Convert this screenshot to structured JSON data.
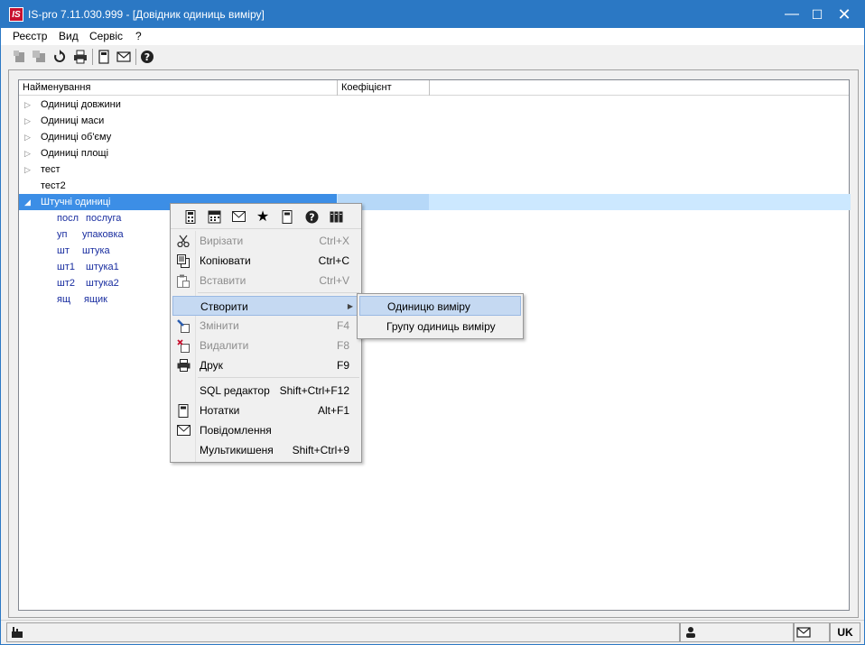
{
  "window": {
    "title": "IS-pro 7.11.030.999 - [Довідник одиниць виміру]",
    "logo_text": "IS"
  },
  "menubar": {
    "items": [
      "Реєстр",
      "Вид",
      "Сервіс",
      "?"
    ]
  },
  "toolbar": {
    "buttons": [
      "add-icon",
      "add-copy-icon",
      "refresh-icon",
      "print-icon",
      "notes-icon",
      "mail-icon",
      "help-icon"
    ]
  },
  "grid": {
    "columns": [
      "Найменування",
      "Коефіцієнт"
    ],
    "groups": [
      {
        "label": "Одиниці довжини",
        "expandable": true
      },
      {
        "label": "Одиниці маси",
        "expandable": true
      },
      {
        "label": "Одиниці об'єму",
        "expandable": true
      },
      {
        "label": "Одиниці площі",
        "expandable": true
      },
      {
        "label": "тест",
        "expandable": true
      },
      {
        "label": "тест2",
        "expandable": false
      },
      {
        "label": "Штучні одиниці",
        "expandable": true,
        "expanded": true,
        "selected": true
      }
    ],
    "children": [
      {
        "code": "посл",
        "name": "послуга"
      },
      {
        "code": "уп",
        "name": "упаковка"
      },
      {
        "code": "шт",
        "name": "штука"
      },
      {
        "code": "шт1",
        "name": "штука1"
      },
      {
        "code": "шт2",
        "name": "штука2"
      },
      {
        "code": "ящ",
        "name": "ящик"
      }
    ]
  },
  "context_menu": {
    "icon_bar": [
      "calculator-icon",
      "calendar-icon",
      "mail-icon",
      "star-icon",
      "notes-icon",
      "help-icon",
      "columns-icon"
    ],
    "items": [
      {
        "label": "Вирізати",
        "shortcut": "Ctrl+X",
        "disabled": true
      },
      {
        "label": "Копіювати",
        "shortcut": "Ctrl+C",
        "disabled": false
      },
      {
        "label": "Вставити",
        "shortcut": "Ctrl+V",
        "disabled": true
      },
      {
        "label": "Створити",
        "shortcut": "",
        "disabled": false,
        "submenu": true
      },
      {
        "label": "Змінити",
        "shortcut": "F4",
        "disabled": true
      },
      {
        "label": "Видалити",
        "shortcut": "F8",
        "disabled": true
      },
      {
        "label": "Друк",
        "shortcut": "F9",
        "disabled": false
      },
      {
        "label": "SQL редактор",
        "shortcut": "Shift+Ctrl+F12",
        "disabled": false
      },
      {
        "label": "Нотатки",
        "shortcut": "Alt+F1",
        "disabled": false
      },
      {
        "label": "Повідомлення",
        "shortcut": "",
        "disabled": false
      },
      {
        "label": "Мультикишеня",
        "shortcut": "Shift+Ctrl+9",
        "disabled": false
      }
    ]
  },
  "submenu": {
    "items": [
      "Одиницю виміру",
      "Групу одиниць виміру"
    ]
  },
  "statusbar": {
    "lang": "UK"
  },
  "colors": {
    "titlebar": "#2b78c4",
    "selection": "#3c8ee6",
    "menu_hover": "#c5d9f2",
    "child_text": "#1a2ea0"
  }
}
